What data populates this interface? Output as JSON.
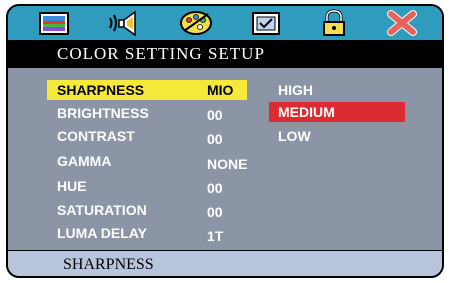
{
  "header": {
    "icons": [
      {
        "name": "picture-icon"
      },
      {
        "name": "speaker-icon"
      },
      {
        "name": "color-palette-icon"
      },
      {
        "name": "checkbox-icon"
      },
      {
        "name": "lock-icon"
      },
      {
        "name": "close-icon"
      }
    ],
    "title": "COLOR SETTING SETUP"
  },
  "settings": [
    {
      "label": "SHARPNESS",
      "value": "MIO",
      "selected": true
    },
    {
      "label": "BRIGHTNESS",
      "value": "00"
    },
    {
      "label": "CONTRAST",
      "value": "00"
    },
    {
      "label": "GAMMA",
      "value": "NONE"
    },
    {
      "label": "HUE",
      "value": "00"
    },
    {
      "label": "SATURATION",
      "value": "00"
    },
    {
      "label": "LUMA DELAY",
      "value": "1T"
    }
  ],
  "options": [
    {
      "label": "HIGH"
    },
    {
      "label": "MEDIUM",
      "active": true
    },
    {
      "label": "LOW"
    }
  ],
  "status": {
    "text": "SHARPNESS"
  },
  "colors": {
    "icon_bar": "#2f9bbd",
    "title_bar": "#000000",
    "menu_bg": "#8c95a6",
    "selected_row": "#f5e93a",
    "active_option": "#dd2b33",
    "status_bar": "#b7c4db"
  }
}
